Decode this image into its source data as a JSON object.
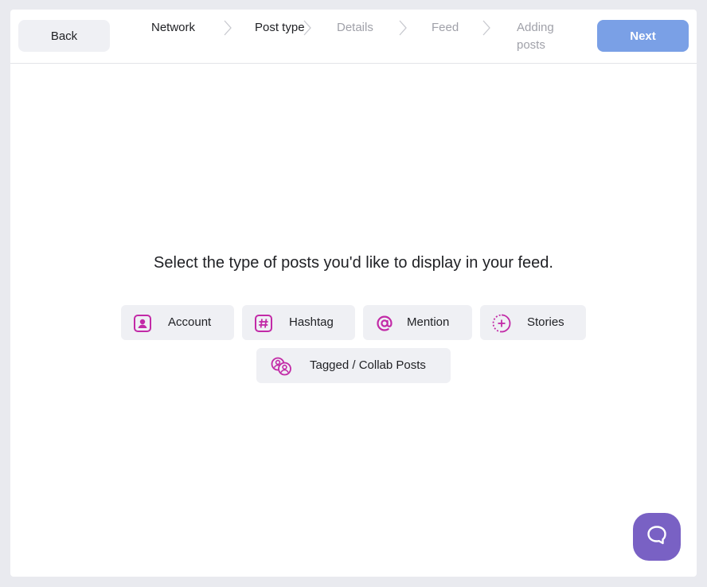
{
  "header": {
    "back_label": "Back",
    "next_label": "Next",
    "steps": [
      {
        "label": "Network",
        "state": "done"
      },
      {
        "label": "Post type",
        "state": "active"
      },
      {
        "label": "Details",
        "state": "upcoming"
      },
      {
        "label": "Feed",
        "state": "upcoming"
      },
      {
        "label": "Adding posts",
        "state": "upcoming"
      }
    ]
  },
  "main": {
    "prompt": "Select the type of posts you'd like to display in your feed.",
    "options": [
      {
        "label": "Account",
        "icon": "account-icon"
      },
      {
        "label": "Hashtag",
        "icon": "hashtag-icon"
      },
      {
        "label": "Mention",
        "icon": "mention-icon"
      },
      {
        "label": "Stories",
        "icon": "stories-icon"
      },
      {
        "label": "Tagged / Collab Posts",
        "icon": "tagged-icon"
      }
    ]
  },
  "colors": {
    "accent_icon": "#c22aa7",
    "next_button": "#7aa0e6",
    "help_button": "#7961c4"
  },
  "help": {
    "icon": "chat-bubble-icon"
  }
}
